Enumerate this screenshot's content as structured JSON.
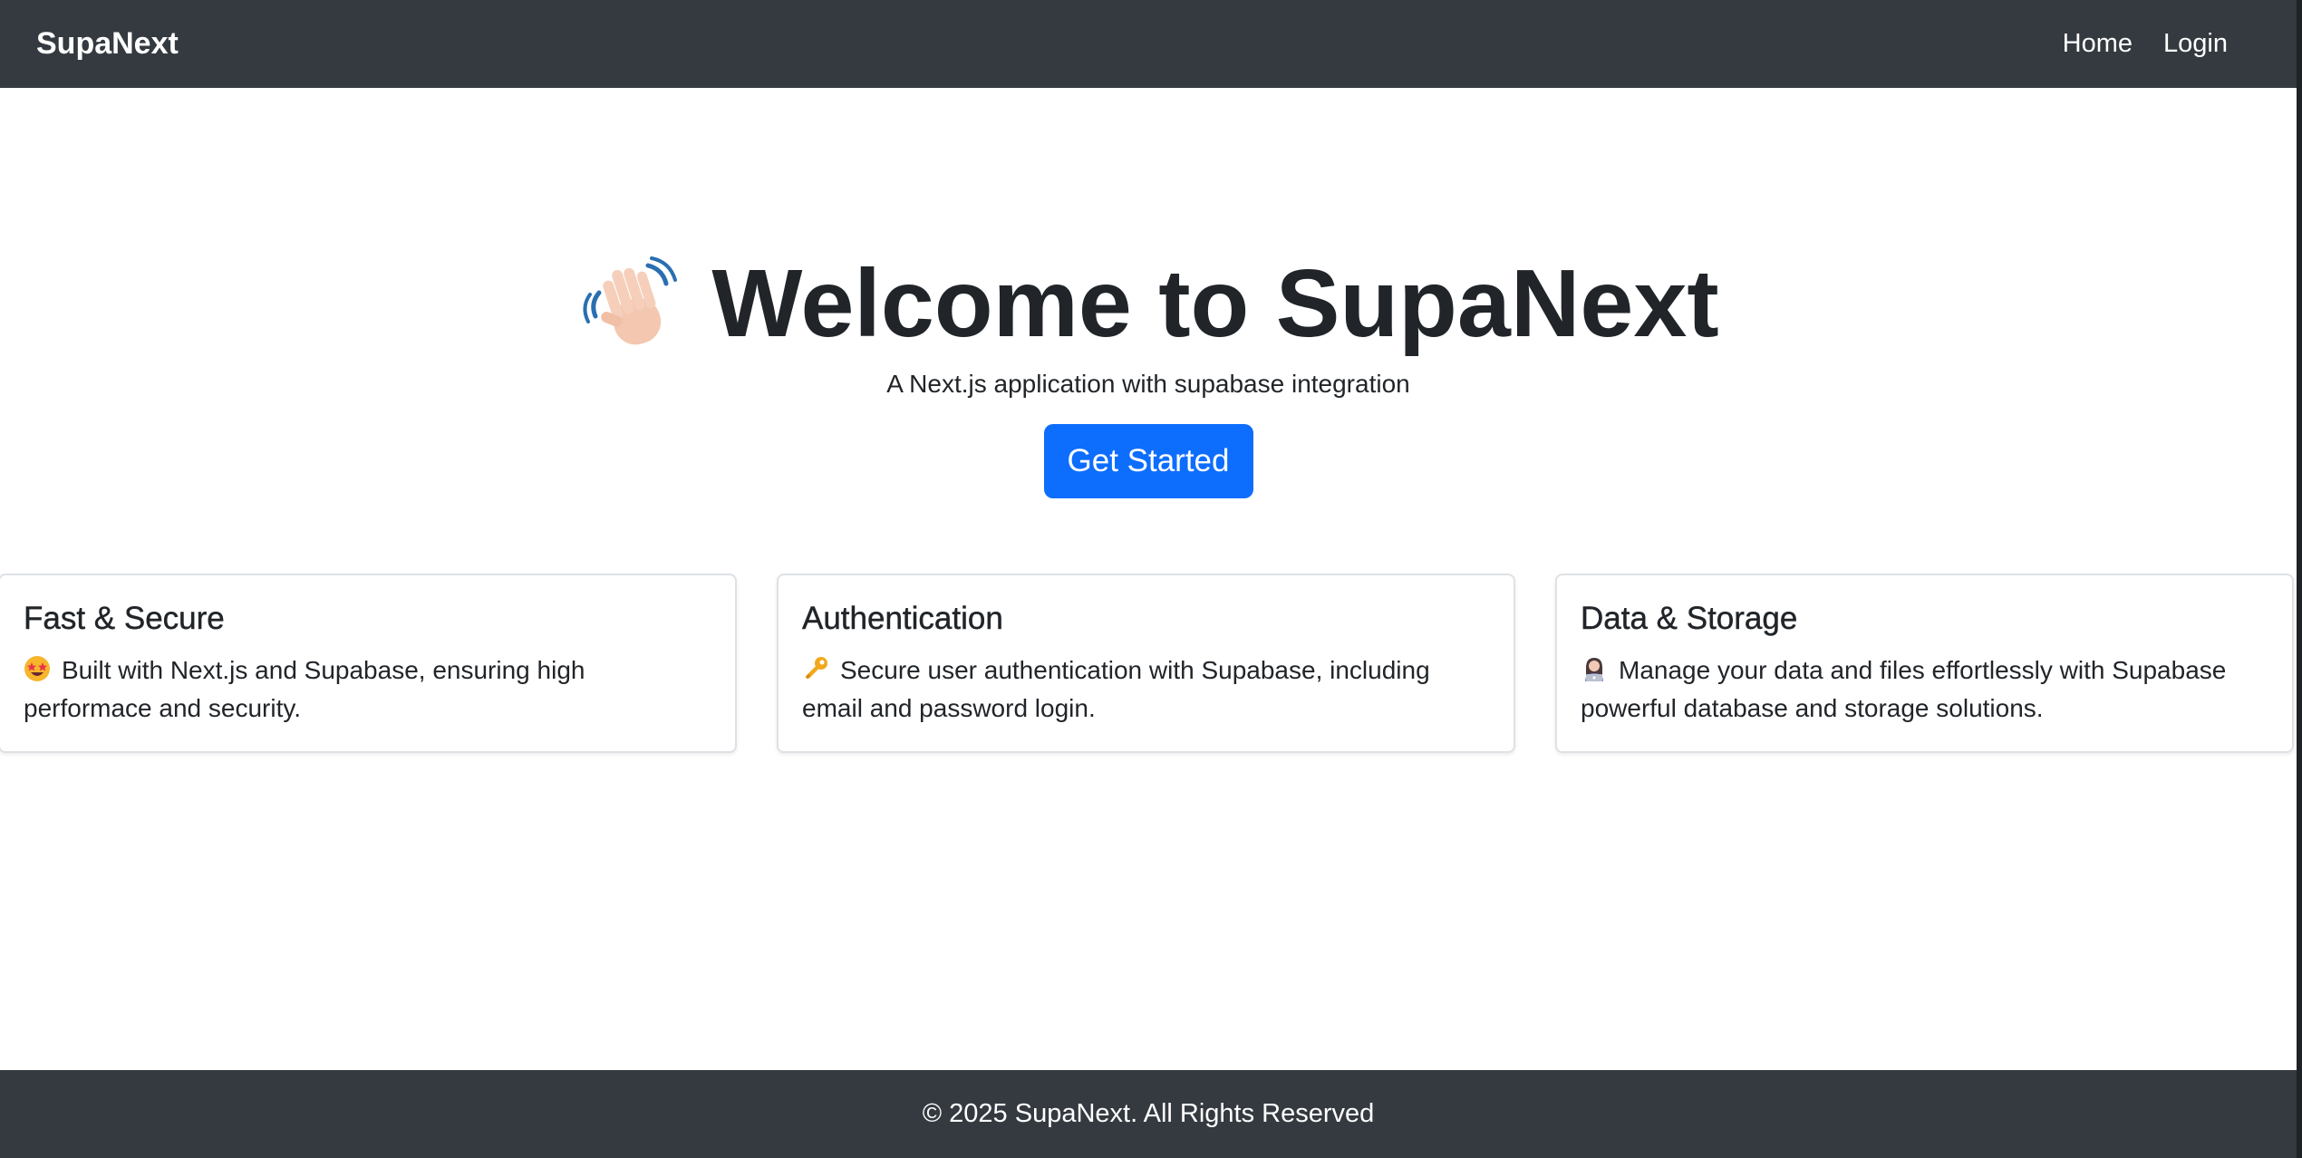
{
  "navbar": {
    "brand": "SupaNext",
    "links": [
      {
        "label": "Home"
      },
      {
        "label": "Login"
      }
    ]
  },
  "hero": {
    "icon": "waving-hand-icon",
    "title": "Welcome to SupaNext",
    "subtitle": "A Next.js application with supabase integration",
    "cta_label": "Get Started"
  },
  "cards": [
    {
      "title": "Fast & Secure",
      "icon": "star-struck-emoji-icon",
      "text": "Built with Next.js and Supabase, ensuring high performace and security."
    },
    {
      "title": "Authentication",
      "icon": "key-icon",
      "text": "Secure user authentication with Supabase, including email and password login."
    },
    {
      "title": "Data & Storage",
      "icon": "technologist-icon",
      "text": "Manage your data and files effortlessly with Supabase powerful database and storage solutions."
    }
  ],
  "footer": {
    "text": "© 2025 SupaNext. All Rights Reserved"
  },
  "colors": {
    "navbar_bg": "#343a40",
    "primary": "#0d6efd",
    "text": "#212529",
    "card_border": "#dee2e6"
  }
}
